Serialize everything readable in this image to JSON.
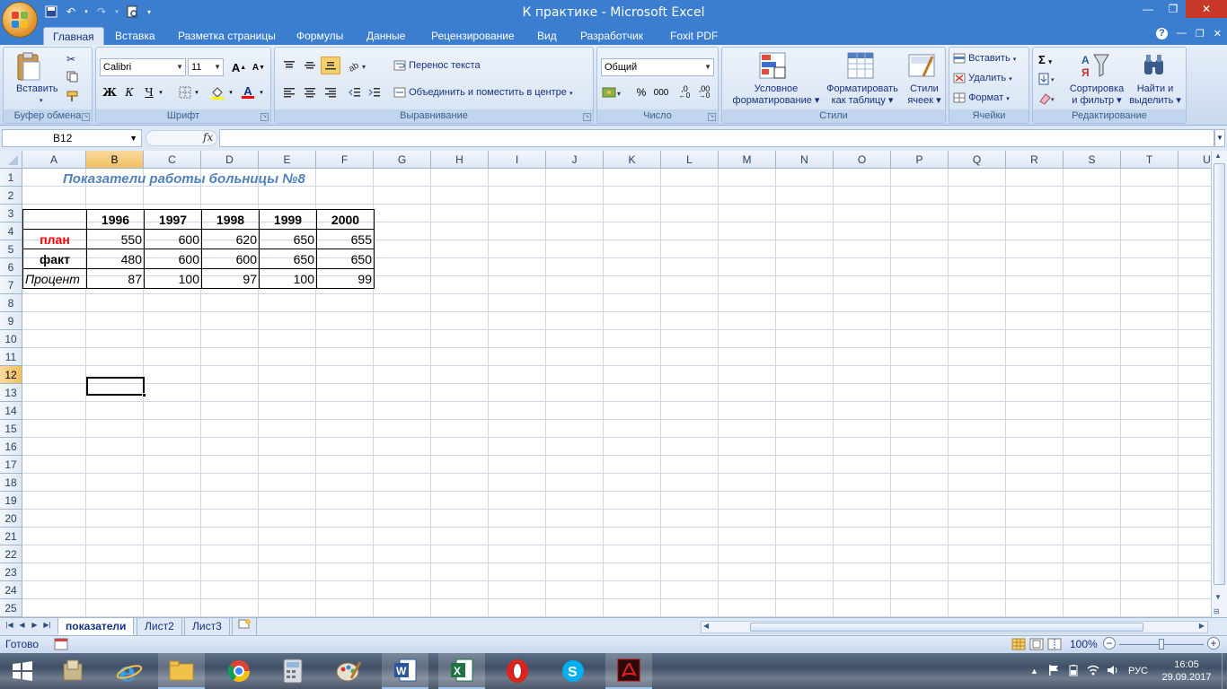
{
  "window": {
    "title": "К практике - Microsoft Excel",
    "buttons": [
      "minimize",
      "restore",
      "close"
    ]
  },
  "quick_access": [
    "save-icon",
    "undo-icon",
    "redo-icon",
    "print-preview-icon",
    "customize-icon"
  ],
  "ribbon_tabs": [
    {
      "label": "Главная",
      "active": true
    },
    {
      "label": "Вставка"
    },
    {
      "label": "Разметка страницы"
    },
    {
      "label": "Формулы"
    },
    {
      "label": "Данные"
    },
    {
      "label": "Рецензирование"
    },
    {
      "label": "Вид"
    },
    {
      "label": "Разработчик"
    },
    {
      "label": "Foxit PDF"
    }
  ],
  "ribbon": {
    "clipboard": {
      "label": "Буфер обмена",
      "paste": "Вставить"
    },
    "font": {
      "label": "Шрифт",
      "name": "Calibri",
      "size": "11",
      "bold": "Ж",
      "italic": "К",
      "underline": "Ч",
      "grow": "A",
      "shrink": "A",
      "color": "A"
    },
    "alignment": {
      "label": "Выравнивание",
      "wrap": "Перенос текста",
      "merge": "Объединить и поместить в центре"
    },
    "number": {
      "label": "Число",
      "format": "Общий",
      "percent": "%",
      "thousands": "000",
      "inc": ",0",
      "dec": ",00"
    },
    "styles": {
      "label": "Стили",
      "conditional_1": "Условное",
      "conditional_2": "форматирование",
      "table_1": "Форматировать",
      "table_2": "как таблицу",
      "cell_1": "Стили",
      "cell_2": "ячеек"
    },
    "cells": {
      "label": "Ячейки",
      "insert": "Вставить",
      "delete": "Удалить",
      "format": "Формат"
    },
    "editing": {
      "label": "Редактирование",
      "sort_1": "Сортировка",
      "sort_2": "и фильтр",
      "find_1": "Найти и",
      "find_2": "выделить"
    }
  },
  "formula_bar": {
    "name_box": "B12",
    "fx": "fx",
    "value": ""
  },
  "columns": [
    "A",
    "B",
    "C",
    "D",
    "E",
    "F",
    "G",
    "H",
    "I",
    "J",
    "K",
    "L",
    "M",
    "N",
    "O",
    "P",
    "Q",
    "R",
    "S",
    "T",
    "U"
  ],
  "rows": [
    "1",
    "2",
    "3",
    "4",
    "5",
    "6",
    "7",
    "8",
    "9",
    "10",
    "11",
    "12",
    "13",
    "14",
    "15",
    "16",
    "17",
    "18",
    "19",
    "20",
    "21",
    "22",
    "23",
    "24",
    "25"
  ],
  "sheet": {
    "title": "Показатели работы больницы №8",
    "table": {
      "header": [
        "",
        "1996",
        "1997",
        "1998",
        "1999",
        "2000"
      ],
      "rows": [
        {
          "label": "план",
          "values": [
            "550",
            "600",
            "620",
            "650",
            "655"
          ]
        },
        {
          "label": "факт",
          "values": [
            "480",
            "600",
            "600",
            "650",
            "650"
          ]
        },
        {
          "label": "Процент",
          "values": [
            "87",
            "100",
            "97",
            "100",
            "99"
          ]
        }
      ]
    },
    "selected_cell": "B12"
  },
  "sheet_tabs": [
    {
      "label": "показатели",
      "active": true
    },
    {
      "label": "Лист2"
    },
    {
      "label": "Лист3"
    }
  ],
  "status": {
    "mode": "Готово",
    "zoom": "100%"
  },
  "taskbar": {
    "apps": [
      "start-icon",
      "files-icon",
      "ie-icon",
      "chrome-icon",
      "file-explorer-icon",
      "calculator-icon",
      "paint-icon",
      "word-icon",
      "excel-icon",
      "opera-icon",
      "skype-icon",
      "acrobat-icon"
    ],
    "lang": "РУС",
    "time": "16:05",
    "date": "29.09.2017"
  },
  "colors": {
    "titlebar": "#3b7dcf",
    "ribbon": "#dfe8f5",
    "title_text": "#4f81bd",
    "plan": "#ff0000",
    "selected_header": "#f1c15f"
  }
}
